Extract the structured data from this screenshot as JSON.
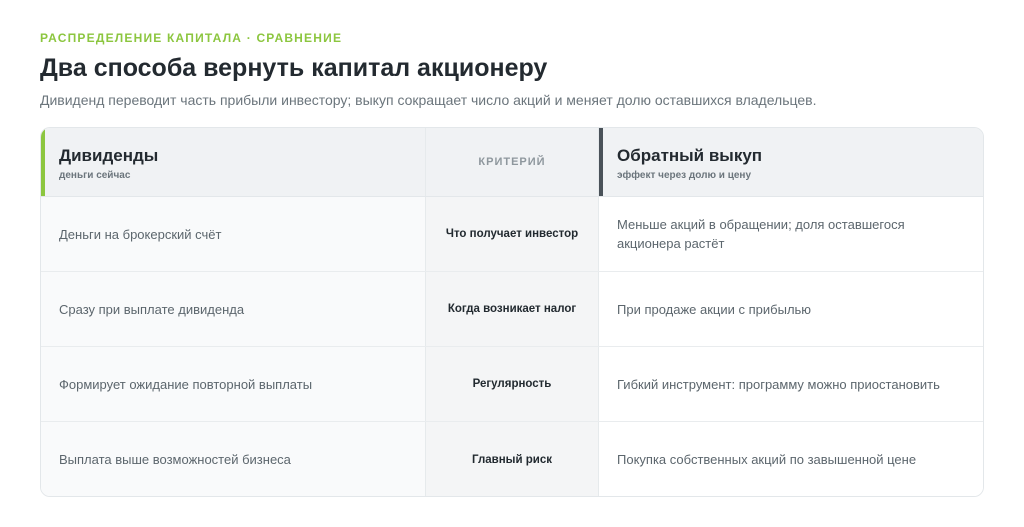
{
  "header": {
    "eyebrow": "РАСПРЕДЕЛЕНИЕ КАПИТАЛА · СРАВНЕНИЕ",
    "title": "Два способа вернуть капитал акционеру",
    "subtitle": "Дивиденд переводит часть прибыли инвестору; выкуп сокращает число акций и меняет долю оставшихся владельцев."
  },
  "table": {
    "left_head": {
      "title": "Дивиденды",
      "sub": "деньги сейчас"
    },
    "mid_head": "КРИТЕРИЙ",
    "right_head": {
      "title": "Обратный выкуп",
      "sub": "эффект через долю и цену"
    },
    "rows": [
      {
        "left": "Деньги на брокерский счёт",
        "criterion": "Что получает инвестор",
        "right": "Меньше акций в обращении; доля оставшегося акционера растёт"
      },
      {
        "left": "Сразу при выплате дивиденда",
        "criterion": "Когда возникает налог",
        "right": "При продаже акции с прибылью"
      },
      {
        "left": "Формирует ожидание повторной выплаты",
        "criterion": "Регулярность",
        "right": "Гибкий инструмент: программу можно приостановить"
      },
      {
        "left": "Выплата выше возможностей бизнеса",
        "criterion": "Главный риск",
        "right": "Покупка собственных акций по завышенной цене"
      }
    ]
  },
  "colors": {
    "accent_green": "#8cc63f",
    "accent_dark": "#4a5259",
    "header_bg": "#f0f2f4"
  }
}
